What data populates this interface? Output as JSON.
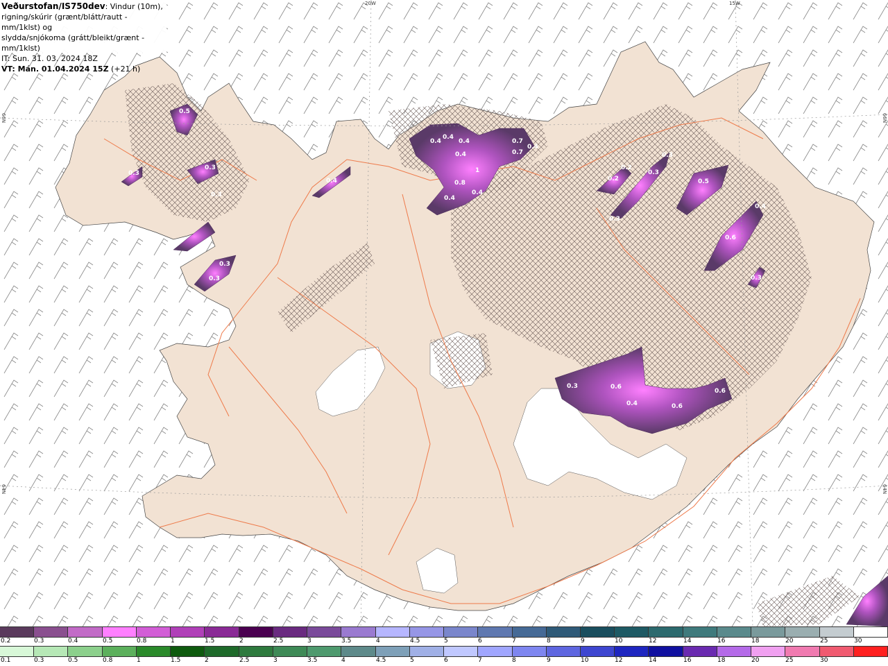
{
  "header": {
    "title": "Veðurstofan/IS750dev",
    "desc1": ": Vindur (10m),",
    "desc2": "rigning/skúrir (grænt/blátt/rautt - mm/1klst) og",
    "desc3": "slydda/snjókoma (grátt/bleikt/grænt - mm/1klst)",
    "it": "IT: Sun. 31. 03. 2024 18Z",
    "vt_label": "VT: Mán. 01.04.2024 15Z",
    "vt_offset": " (+21 h)"
  },
  "graticule": {
    "lon_20": "20W",
    "lon_15": "15W",
    "lat_66_left": "66N",
    "lat_66_right": "66N",
    "lat_64_left": "64N",
    "lat_64_right": "64N"
  },
  "precip_labels": [
    "0.5",
    "0.3",
    "0.3",
    "0.3",
    "0.3",
    "0.3",
    "0.4",
    "0.4",
    "0.4",
    "0.4",
    "0.4",
    "0.7",
    "0.7",
    "0.4",
    "0.4",
    "1",
    "0.8",
    "0.4",
    "0.2",
    "0.2",
    "0.3",
    "0.3",
    "0.3",
    "0.5",
    "0.4",
    "0.6",
    "0.3",
    "0.3",
    "0.6",
    "0.4",
    "0.6",
    "0.6"
  ],
  "legend_snow": {
    "colors": [
      "#5a3a5c",
      "#8a4f8f",
      "#c26bc7",
      "#ff7fff",
      "#d25ed6",
      "#b040b8",
      "#8a2a96",
      "#4a0050",
      "#6a2a80",
      "#7a4a9a",
      "#9a7ad0",
      "#b6b6ff",
      "#9696e6",
      "#7a86cc",
      "#5f78b0",
      "#466a96",
      "#2f5a78",
      "#1a4e5e",
      "#1e5a64",
      "#2c6a6e",
      "#3f7a7c",
      "#5a8a8c",
      "#7a9a9c",
      "#9aaeb0",
      "#c4ccd0",
      "#ffffff"
    ],
    "ticks": [
      "0.2",
      "0.3",
      "0.4",
      "0.5",
      "0.8",
      "1",
      "1.5",
      "2",
      "2.5",
      "3",
      "3.5",
      "4",
      "4.5",
      "5",
      "6",
      "7",
      "8",
      "9",
      "10",
      "12",
      "14",
      "16",
      "18",
      "20",
      "25",
      "30"
    ]
  },
  "legend_rain": {
    "colors": [
      "#d8f8d8",
      "#b6e8b6",
      "#8cd08c",
      "#5cb05c",
      "#2a8a2a",
      "#0e5a0e",
      "#1e6a2a",
      "#2e7a3e",
      "#3e8a56",
      "#4e9a6e",
      "#5e8a8a",
      "#7ea0b8",
      "#a0b0e6",
      "#c0c8ff",
      "#a0a6ff",
      "#7e86f0",
      "#5e66e0",
      "#3e46d0",
      "#1e26c0",
      "#1010a0",
      "#6a2ab0",
      "#b46ae8",
      "#f0a0f0",
      "#f07ab0",
      "#f05a70",
      "#ff2020"
    ],
    "ticks": [
      "0.1",
      "0.3",
      "0.5",
      "0.8",
      "1",
      "1.5",
      "2",
      "2.5",
      "3",
      "3.5",
      "4",
      "4.5",
      "5",
      "6",
      "7",
      "8",
      "9",
      "10",
      "12",
      "14",
      "16",
      "18",
      "20",
      "25",
      "30"
    ]
  }
}
